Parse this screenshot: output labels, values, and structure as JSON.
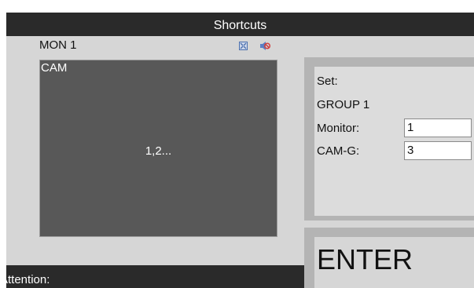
{
  "window": {
    "title": "Shortcuts"
  },
  "monitor": {
    "label": "MON 1"
  },
  "icons": {
    "fullscreen": "fullscreen-icon",
    "mute": "mute-icon"
  },
  "video": {
    "cam_label": "CAM",
    "cam_list": "1,2..."
  },
  "settings": {
    "set_label": "Set:",
    "group_label": "GROUP 1",
    "monitor_label": "Monitor:",
    "monitor_value": "1",
    "camg_label": "CAM-G:",
    "camg_value": "3"
  },
  "enter_label": "ENTER",
  "status": {
    "attention_label": "Attention:"
  },
  "colors": {
    "title_bar": "#2a2a2a",
    "panel": "#d6d6d6",
    "video_bg": "#585858",
    "icon_blue": "#4a6fae",
    "icon_red": "#d04040"
  }
}
